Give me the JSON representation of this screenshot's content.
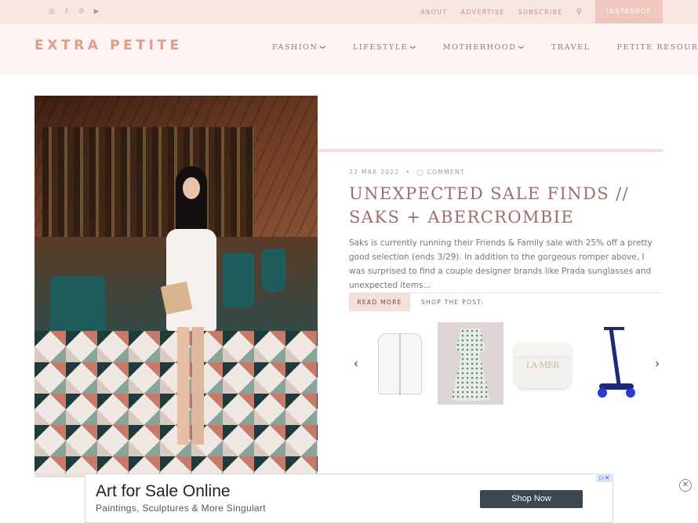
{
  "topbar": {
    "social_icons": [
      "instagram-icon",
      "facebook-icon",
      "pinterest-icon",
      "youtube-icon"
    ],
    "social_glyphs": [
      "◎",
      "f",
      "℗",
      "▶"
    ],
    "links": [
      "ABOUT",
      "ADVERTISE",
      "SUBSCRIBE"
    ],
    "search_glyph": "⚲",
    "instashop": "INSTASHOP"
  },
  "header": {
    "logo": "EXTRA PETITE",
    "nav": [
      {
        "label": "FASHION",
        "dropdown": true
      },
      {
        "label": "LIFESTYLE",
        "dropdown": true
      },
      {
        "label": "MOTHERHOOD",
        "dropdown": true
      },
      {
        "label": "TRAVEL",
        "dropdown": false
      },
      {
        "label": "PETITE RESOURCES",
        "dropdown": true
      }
    ],
    "caret_glyph": "❯"
  },
  "post": {
    "date": "22 MAR 2022",
    "separator": "•",
    "comment_glyph": "◯",
    "comment_label": "COMMENT",
    "title": "UNEXPECTED SALE FINDS // SAKS + ABERCROMBIE",
    "excerpt": "Saks is currently running their Friends & Family sale with 25% off a pretty good selection (ends 3/29). In addition to the gorgeous romper above, I was surprised to find a couple designer brands like Prada sunglasses and unexpected items...",
    "read_more": "READ MORE",
    "shop_label": "SHOP THE POST:"
  },
  "carousel": {
    "prev_glyph": "‹",
    "next_glyph": "›",
    "jar_label": "LA MER"
  },
  "ad": {
    "title": "Art for Sale Online",
    "subtitle": "Paintings, Sculptures & More Singulart",
    "button": "Shop Now",
    "adchoices_glyph": "▷✕",
    "close_glyph": "✕"
  },
  "colors": {
    "topbar_bg": "#f7e6e1",
    "header_bg": "#fbf4f2",
    "accent": "#e49a88",
    "title": "#9e6f66"
  }
}
